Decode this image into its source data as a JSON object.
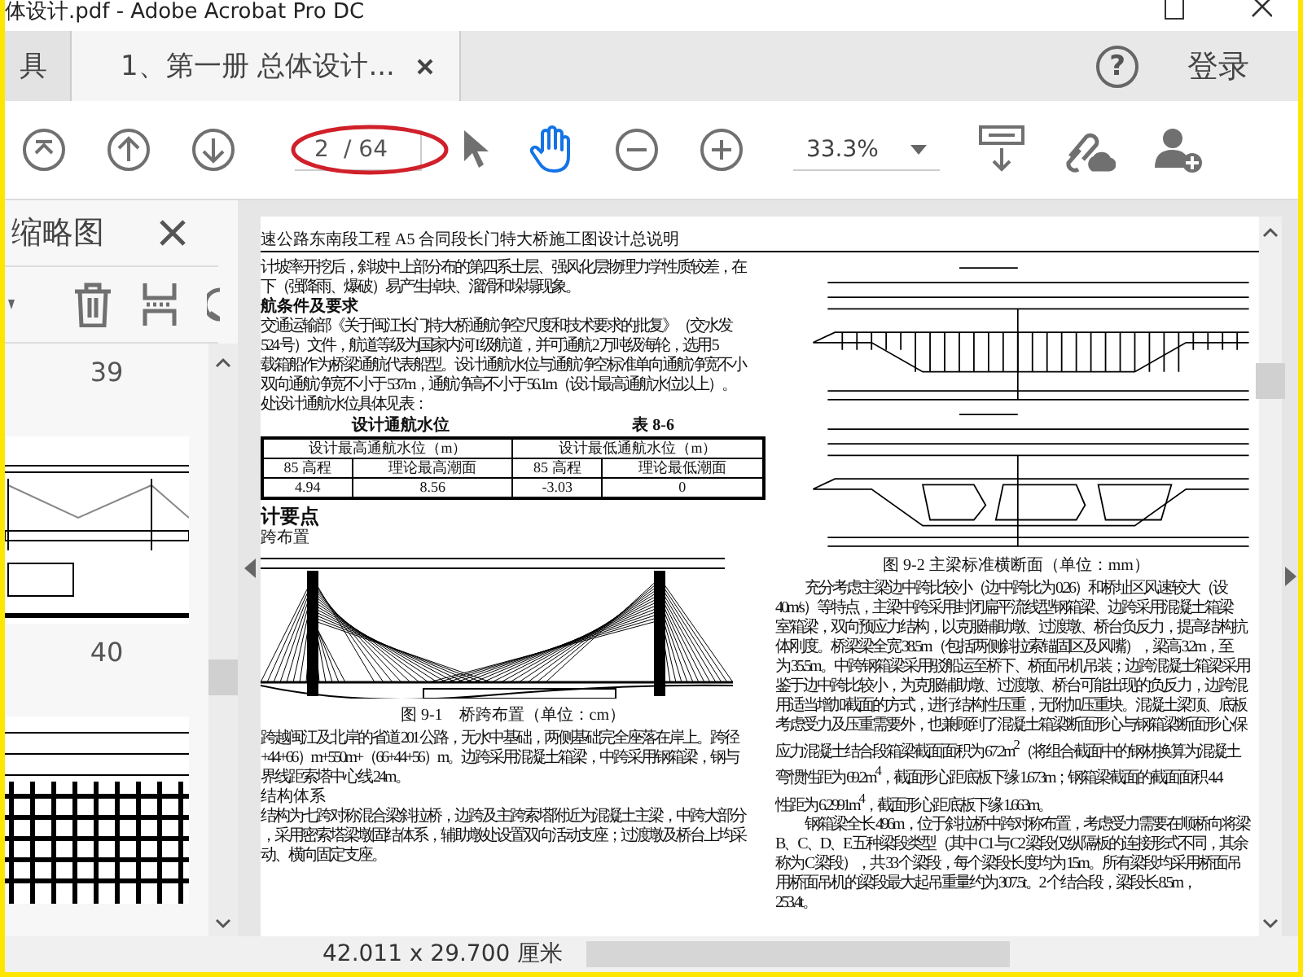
{
  "window": {
    "title": "体设计.pdf - Adobe Acrobat Pro DC"
  },
  "tabs": [
    {
      "label": "具",
      "selected": false
    },
    {
      "label": "1、第一册 总体设计...",
      "selected": true
    }
  ],
  "header": {
    "help": "?",
    "sign_in": "登录"
  },
  "toolbar": {
    "page_current": "2",
    "page_total": "/ 64",
    "zoom": "33.3%",
    "tools": [
      {
        "kind": "select",
        "selected": false
      },
      {
        "kind": "hand",
        "selected": true
      }
    ]
  },
  "sidebar": {
    "title": "缩略图",
    "thumbnails": [
      {
        "label": "39"
      },
      {
        "label": "40"
      }
    ]
  },
  "document": {
    "header": "速公路东南段工程 A5 合同段长门特大桥施工图设计总说明",
    "left": [
      {
        "kind": "paragraph",
        "lines": [
          "计坡率开挖后，斜坡中上部分布的第四系土层、强风化层物理力学性质较差，在",
          "下（强降雨、爆破）易产生掉块、溜滑和垛塌现象。"
        ]
      },
      {
        "kind": "subheading",
        "text": "航条件及要求"
      },
      {
        "kind": "paragraph",
        "lines": [
          "交通运输部《关于闽江长门特大桥通航净空尺度和技术要求的批复》（交水发",
          "524 号）文件，航道等级为国家内河 I 级航道，并可通航 2 万吨级海轮，选用 5",
          "载箱船作为桥梁通航代表船型。设计通航水位与通航净空标准单向通航净宽不小",
          "双向通航净宽不小于 537m，通航净高不小于 56.1m（设计最高通航水位以上）。",
          "处设计通航水位具体见表："
        ]
      },
      {
        "kind": "table",
        "title": "设计通航水位",
        "number": "表 8-6",
        "groups": [
          "设计最高通航水位（m）",
          "设计最低通航水位（m）"
        ],
        "columns": [
          "85 高程",
          "理论最高潮面",
          "85 高程",
          "理论最低潮面"
        ],
        "rows": [
          [
            "4.94",
            "8.56",
            "-3.03",
            "0"
          ]
        ]
      },
      {
        "kind": "heading",
        "text": "计要点"
      },
      {
        "kind": "plain",
        "text": "跨布置"
      },
      {
        "kind": "figure"
      },
      {
        "kind": "caption",
        "text": "图 9-1　桥跨布置（单位：cm）"
      },
      {
        "kind": "paragraph",
        "lines": [
          "跨越闽江及北岸的省道 201 公路，无水中基础，两侧基础完全座落在岸上。跨径",
          "+44+66）m+550m+（66+44+56）m。边跨采用混凝土箱梁，中跨采用钢箱梁，钢与",
          "界线距索塔中心线 24m。"
        ]
      },
      {
        "kind": "plain",
        "text": "结构体系"
      },
      {
        "kind": "paragraph",
        "lines": [
          "结构为七跨对称混合梁斜拉桥，边跨及主跨索塔附近为混凝土主梁，中跨大部分",
          "，采用密索塔梁墩固结体系，辅助墩处设置双向活动支座；过渡墩及桥台上均采",
          "动、横向固定支座。"
        ]
      }
    ],
    "right": [
      {
        "kind": "sections"
      },
      {
        "kind": "caption",
        "text": "图 9-2 主梁标准横断面（单位：mm）"
      },
      {
        "kind": "paragraph",
        "lines": [
          "充分考虑主梁边中跨比较小（边中跨比为 0.26）和桥址区风速较大（设",
          "40m/s）等特点，主梁中跨采用封闭扁平流线型钢箱梁、边跨采用混凝土箱梁",
          "室箱梁，双向预应力结构，以克服辅助墩、过渡墩、桥台负反力，提高结构抗",
          "体刚度。桥梁梁全宽 38.5m（包括两侧斜拉索锚固区及风嘴），梁高 3.2m，至",
          "为 35.5m。中跨钢箱梁采用驳船运至桥下、桥面吊机吊装；边跨混凝土箱梁采用",
          "鉴于边中跨比较小，为克服辅助墩、过渡墩、桥台可能出现的负反力，边跨混",
          "用适当增加截面的方式，进行结构性压重，无附加压重块。混凝土梁顶、底板",
          "考虑受力及压重需要外，也兼顾到了混凝土箱梁断面形心与钢箱梁断面形心保",
          "应力混凝土结合段箱梁截面面积为 67.2m$^{2}$（将组合截面中的钢材换算为混凝土",
          "弯惯性距为 69.2m$^{4}$，截面形心距底板下缘 1.673m；钢箱梁截面的截面面积 4.4",
          "性距为 6.2991m$^{4}$，截面形心距底板下缘 1.663m。"
        ]
      },
      {
        "kind": "paragraph",
        "lines": [
          "钢箱梁全长 496m，位于斜拉桥中跨对称布置，考虑受力需要在顺桥向将梁",
          "B、C、D、E 五种梁段类型（其中 C1 与 C2 梁段仅纵隔板的连接形式不同，其余",
          "称为 C 梁段），共 33 个梁段，每个梁段长度均为 15m。所有梁段均采用桥面吊",
          "用桥面吊机的梁段最大起吊重量约为 307.5t。2 个结合段，梁段长 8.5m，",
          "253.4t。"
        ]
      }
    ]
  },
  "status_bar": {
    "page_size": "42.011 x 29.700 厘米"
  }
}
